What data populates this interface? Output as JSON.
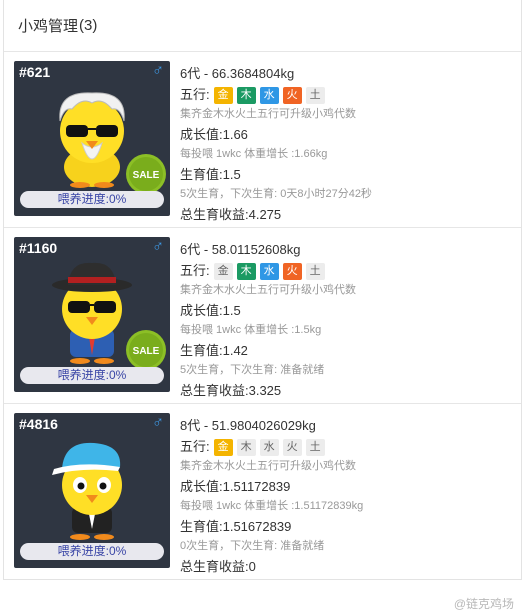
{
  "header": {
    "title": "小鸡管理",
    "count": "(3)"
  },
  "common": {
    "wuxing_label": "五行:",
    "wuxing_hint": "集齐金木水火土五行可升级小鸡代数",
    "progress_label": "喂养进度:0%",
    "sale_label": "SALE",
    "gender_symbol": "♂"
  },
  "wuxing_names": [
    "金",
    "木",
    "水",
    "火",
    "土"
  ],
  "chicks": [
    {
      "id": "#621",
      "generation_weight": "6代 - 66.3684804kg",
      "wuxing_active": [
        true,
        true,
        true,
        true,
        false
      ],
      "growth": "成长值:1.66",
      "feed_hint": "每投喂 1wkc 体重增长 :1.66kg",
      "fertility": "生育值:1.5",
      "breed_status": "5次生育，下次生育: 0天8小时27分42秒",
      "income": "总生育收益:4.275",
      "on_sale": true,
      "hat_color": "#e8e8e8"
    },
    {
      "id": "#1160",
      "generation_weight": "6代 - 58.01152608kg",
      "wuxing_active": [
        false,
        true,
        true,
        true,
        false
      ],
      "growth": "成长值:1.5",
      "feed_hint": "每投喂 1wkc 体重增长 :1.5kg",
      "fertility": "生育值:1.42",
      "breed_status": "5次生育，下次生育: 准备就绪",
      "income": "总生育收益:3.325",
      "on_sale": true,
      "hat_color": "#333333"
    },
    {
      "id": "#4816",
      "generation_weight": "8代 - 51.9804026029kg",
      "wuxing_active": [
        true,
        false,
        false,
        false,
        false
      ],
      "growth": "成长值:1.51172839",
      "feed_hint": "每投喂 1wkc 体重增长 :1.51172839kg",
      "fertility": "生育值:1.51672839",
      "breed_status": "0次生育，下次生育: 准备就绪",
      "income": "总生育收益:0",
      "on_sale": false,
      "hat_color": "#3fb5e8"
    }
  ],
  "watermark": "@链克鸡场",
  "colors": {
    "gold": "#f4b400",
    "wood": "#1b9a63",
    "water": "#2f97e5",
    "fire": "#f06424",
    "card_bg": "#2f3642"
  }
}
